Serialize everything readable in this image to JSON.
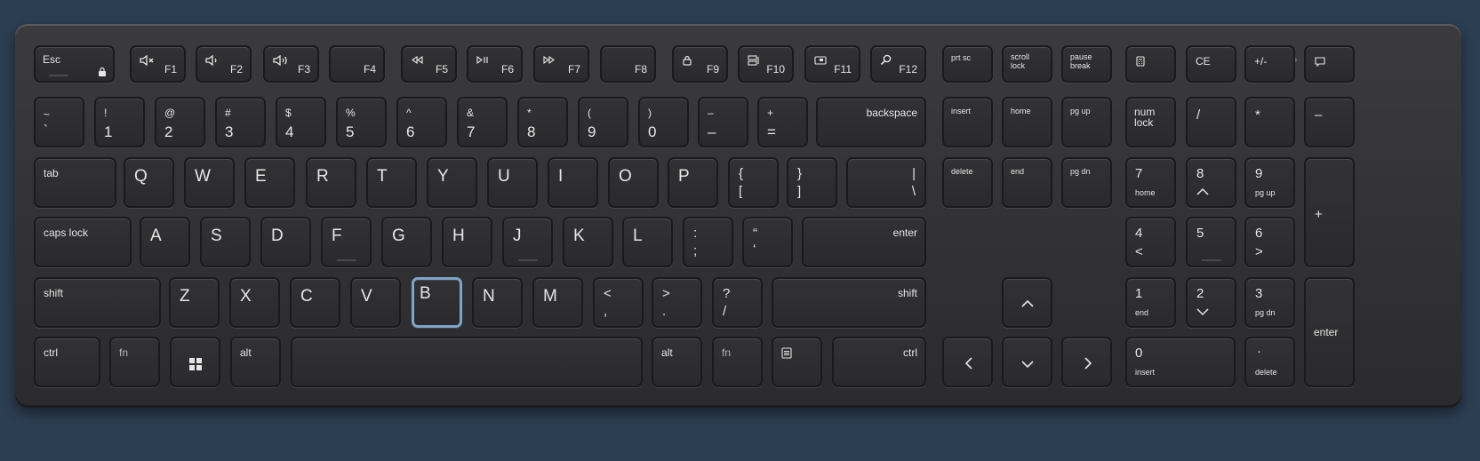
{
  "keyboard": {
    "esc": "Esc",
    "f1": "F1",
    "f2": "F2",
    "f3": "F3",
    "f4": "F4",
    "f5": "F5",
    "f6": "F6",
    "f7": "F7",
    "f8": "F8",
    "f9": "F9",
    "f10": "F10",
    "f11": "F11",
    "f12": "F12",
    "prtsc": "prt sc",
    "scroll_1": "scroll",
    "scroll_2": "lock",
    "pause_1": "pause",
    "pause_2": "break",
    "ce": "CE",
    "plusminus": "+/-",
    "tilde": "~",
    "backtick": "`",
    "r1": [
      "!",
      "@",
      "#",
      "$",
      "%",
      "^",
      "&",
      "*",
      "(",
      ")",
      "–",
      "+"
    ],
    "r1b": [
      "1",
      "2",
      "3",
      "4",
      "5",
      "6",
      "7",
      "8",
      "9",
      "0",
      "–",
      "="
    ],
    "backspace": "backspace",
    "insert": "insert",
    "home": "home",
    "pgup": "pg up",
    "numlock_1": "num",
    "numlock_2": "lock",
    "np_slash": "/",
    "np_star": "*",
    "np_minus": "–",
    "tab": "tab",
    "row_q": [
      "Q",
      "W",
      "E",
      "R",
      "T",
      "Y",
      "U",
      "I",
      "O",
      "P"
    ],
    "lbrace": "{",
    "lbracket": "[",
    "rbrace": "}",
    "rbracket": "]",
    "pipe": "|",
    "backslash": "\\",
    "delete": "delete",
    "end": "end",
    "pgdn": "pg dn",
    "np7": "7",
    "np7b": "home",
    "np8": "8",
    "np9": "9",
    "np9b": "pg up",
    "np_plus": "+",
    "caps": "caps lock",
    "row_a": [
      "A",
      "S",
      "D",
      "F",
      "G",
      "H",
      "J",
      "K",
      "L"
    ],
    "colon": ":",
    "semicolon": ";",
    "quote_top": "“",
    "quote_bot": "‘",
    "enter": "enter",
    "np4": "4",
    "np4b": "<",
    "np5": "5",
    "np6": "6",
    "np6b": ">",
    "shift": "shift",
    "row_z": [
      "Z",
      "X",
      "C",
      "V",
      "B",
      "N",
      "M"
    ],
    "lt": "<",
    "comma": ",",
    "gt": ">",
    "period": ".",
    "question": "?",
    "slash": "/",
    "np1": "1",
    "np1b": "end",
    "np2": "2",
    "np3": "3",
    "np3b": "pg dn",
    "np_enter": "enter",
    "ctrl": "ctrl",
    "fn": "fn",
    "alt": "alt",
    "np0": "0",
    "np0b": "insert",
    "npdot": "·",
    "npdotb": "delete",
    "selected_key": "B"
  }
}
